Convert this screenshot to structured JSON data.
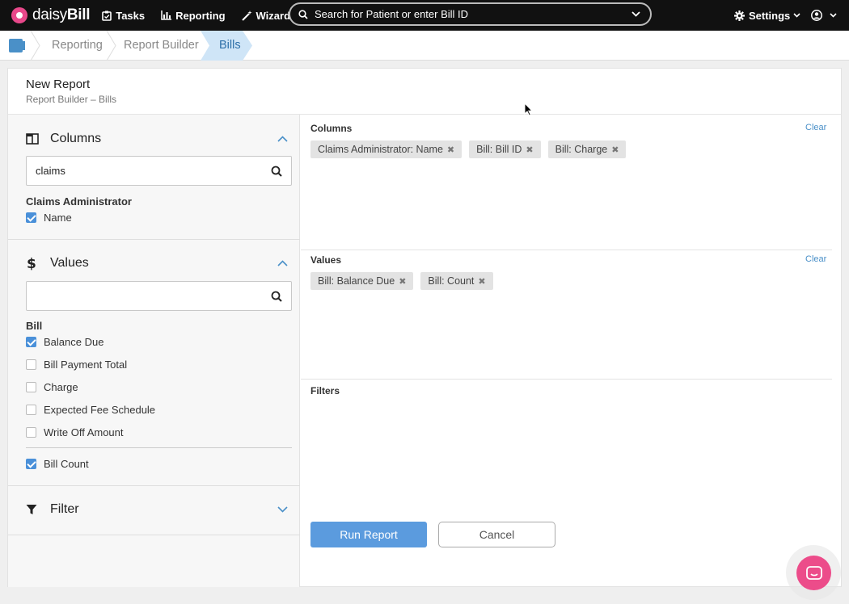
{
  "nav": {
    "brand_light": "daisy",
    "brand_bold": "Bill",
    "tasks": "Tasks",
    "reporting": "Reporting",
    "wizard": "Wizard",
    "search_placeholder": "Search for Patient or enter Bill ID",
    "settings": "Settings"
  },
  "breadcrumb": {
    "items": [
      "Reporting",
      "Report Builder",
      "Bills"
    ]
  },
  "report": {
    "title": "New Report",
    "subtitle": "Report Builder – Bills"
  },
  "sidebar": {
    "columns": {
      "title": "Columns",
      "search_value": "claims",
      "group": "Claims Administrator",
      "items": [
        {
          "label": "Name",
          "checked": true
        }
      ]
    },
    "values": {
      "title": "Values",
      "search_value": "",
      "group": "Bill",
      "items": [
        {
          "label": "Balance Due",
          "checked": true
        },
        {
          "label": "Bill Payment Total",
          "checked": false
        },
        {
          "label": "Charge",
          "checked": false
        },
        {
          "label": "Expected Fee Schedule",
          "checked": false
        },
        {
          "label": "Write Off Amount",
          "checked": false
        }
      ],
      "count_item": {
        "label": "Bill Count",
        "checked": true
      }
    },
    "filter": {
      "title": "Filter"
    }
  },
  "panel": {
    "columns_label": "Columns",
    "values_label": "Values",
    "filters_label": "Filters",
    "clear": "Clear",
    "column_chips": [
      "Claims Administrator: Name",
      "Bill: Bill ID",
      "Bill: Charge"
    ],
    "value_chips": [
      "Bill: Balance Due",
      "Bill: Count"
    ]
  },
  "actions": {
    "run": "Run Report",
    "cancel": "Cancel"
  },
  "colors": {
    "accent": "#4a90d9",
    "primary_button": "#5b9bde",
    "brand_pink": "#ec4c8a",
    "nav_bg": "#111111"
  }
}
